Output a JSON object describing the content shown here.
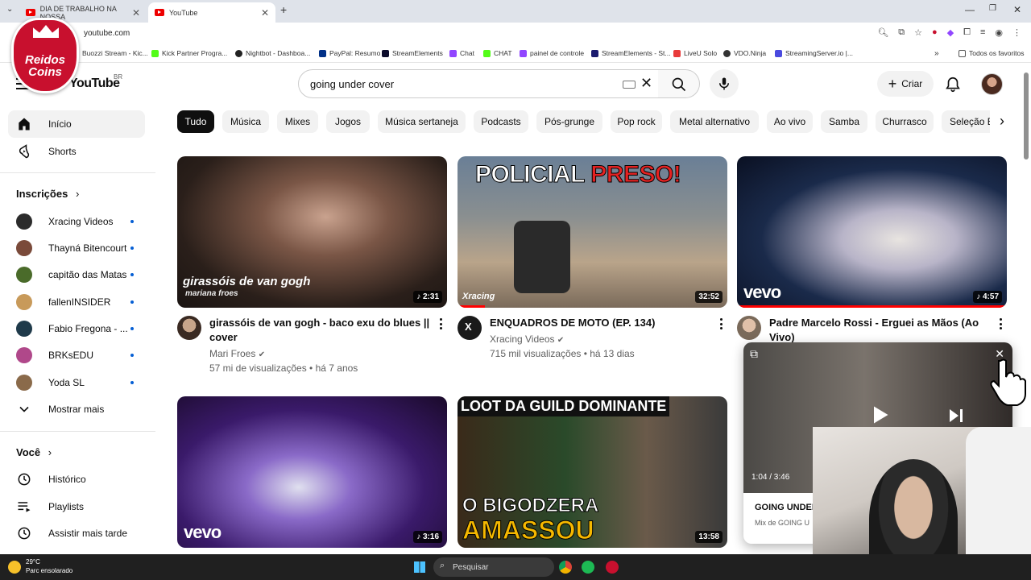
{
  "browser": {
    "tabs": [
      {
        "title": "DIA DE TRABALHO NA NOSSA"
      },
      {
        "title": "YouTube"
      }
    ],
    "url": "youtube.com",
    "bookmarks": [
      {
        "label": "Buozzi Stream - Kic...",
        "color": "#53fc18"
      },
      {
        "label": "Kick Partner Progra...",
        "color": "#53fc18"
      },
      {
        "label": "Nightbot - Dashboa...",
        "color": "#222222"
      },
      {
        "label": "PayPal: Resumo",
        "color": "#003087"
      },
      {
        "label": "StreamElements",
        "color": "#0b0b2b"
      },
      {
        "label": "Chat",
        "color": "#9146ff"
      },
      {
        "label": "CHAT",
        "color": "#53fc18"
      },
      {
        "label": "painel de controle",
        "color": "#9146ff"
      },
      {
        "label": "StreamElements - St...",
        "color": "#1a1a6e"
      },
      {
        "label": "LiveU Solo",
        "color": "#e83b3b"
      },
      {
        "label": "VDO.Ninja",
        "color": "#333333"
      },
      {
        "label": "StreamingServer.io |...",
        "color": "#4a4adf"
      }
    ],
    "bookmarks_folder": "Todos os favoritos"
  },
  "overlay_logo": {
    "text": "Rei dos Coins"
  },
  "header": {
    "logo": "YouTube",
    "region": "BR",
    "search_value": "going under cover",
    "create_label": "Criar"
  },
  "sidebar": {
    "main": [
      {
        "label": "Início",
        "icon": "home-icon"
      },
      {
        "label": "Shorts",
        "icon": "shorts-icon"
      }
    ],
    "subscriptions_title": "Inscrições",
    "subscriptions": [
      {
        "label": "Xracing Videos",
        "color": "#2b2b2b"
      },
      {
        "label": "Thayná Bitencourt",
        "color": "#7a4a3a"
      },
      {
        "label": "capitão das Matas",
        "color": "#4a6b2a"
      },
      {
        "label": "fallenINSIDER",
        "color": "#c89a5a"
      },
      {
        "label": "Fabio Fregona - ...",
        "color": "#1f3a4a"
      },
      {
        "label": "BRKsEDU",
        "color": "#b0488a"
      },
      {
        "label": "Yoda SL",
        "color": "#8a6a4a"
      }
    ],
    "show_more": "Mostrar mais",
    "you_title": "Você",
    "you_items": [
      {
        "label": "Histórico",
        "icon": "history-icon"
      },
      {
        "label": "Playlists",
        "icon": "playlists-icon"
      },
      {
        "label": "Assistir mais tarde",
        "icon": "watch-later-icon"
      }
    ]
  },
  "chips": [
    "Tudo",
    "Música",
    "Mixes",
    "Jogos",
    "Música sertaneja",
    "Podcasts",
    "Pós-grunge",
    "Pop rock",
    "Metal alternativo",
    "Ao vivo",
    "Samba",
    "Churrasco",
    "Seleção Br"
  ],
  "videos": [
    {
      "title": "girassóis de van gogh - baco exu do blues || cover",
      "channel": "Mari Froes",
      "meta": "57 mi de visualizações • há 7 anos",
      "duration": "2:31",
      "thumb_text": "girassóis de van gogh",
      "thumb_sub": "mariana froes"
    },
    {
      "title": "ENQUADROS DE MOTO (EP. 134)",
      "channel": "Xracing Videos",
      "meta": "715 mil visualizações • há 13 dias",
      "duration": "32:52",
      "thumb_text_a": "POLICIAL",
      "thumb_text_b": "PRESO!",
      "thumb_logo": "Xracing",
      "watched": 0.1
    },
    {
      "title": "Padre Marcelo Rossi - Erguei as Mãos (Ao Vivo)",
      "duration": "4:57",
      "thumb_logo": "vevo",
      "watched": 1.0
    },
    {
      "duration": "3:16",
      "thumb_logo": "vevo"
    },
    {
      "duration": "13:58",
      "thumb_text_a": "LOOT DA GUILD DOMINANTE",
      "thumb_text_b": "O BIGODZERA",
      "thumb_text_c": "AMASSOU"
    }
  ],
  "mini_player": {
    "time": "1:04 / 3:46",
    "title": "GOING UNDER",
    "subtitle": "Mix de GOING U"
  },
  "taskbar": {
    "temp": "29°C",
    "weather": "Parc ensolarado",
    "search": "Pesquisar"
  },
  "colors": {
    "accent": "#ff0000",
    "brand_logo": "#c8102e",
    "verified": "#606060"
  }
}
